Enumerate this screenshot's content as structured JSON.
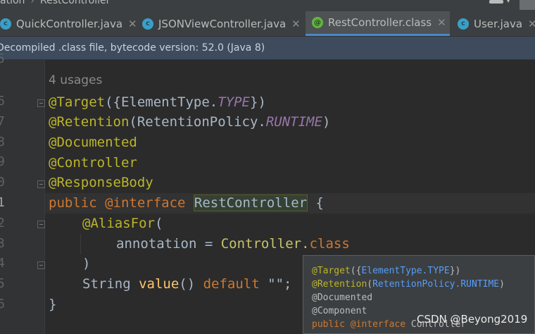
{
  "breadcrumb": {
    "left": "ation",
    "right": "RestController"
  },
  "tabs": [
    {
      "label": "QuickController.java",
      "icon": "class-icon",
      "active": false
    },
    {
      "label": "JSONViewController.java",
      "icon": "class-icon",
      "active": false
    },
    {
      "label": "RestController.class",
      "icon": "annotation-icon",
      "active": true
    },
    {
      "label": "User.java",
      "icon": "class-icon",
      "active": false
    }
  ],
  "banner": "Decompiled .class file, bytecode version: 52.0 (Java 8)",
  "gutter": {
    "line_numbers": [
      "5",
      "6",
      "7",
      "8",
      "9",
      "0",
      "1",
      "2",
      "3",
      "4",
      "5",
      "6"
    ]
  },
  "editor": {
    "usages": "4 usages",
    "l6": {
      "a": "@Target",
      "b": "({ElementType.",
      "c": "TYPE",
      "d": "})"
    },
    "l7": {
      "a": "@Retention",
      "b": "(RetentionPolicy.",
      "c": "RUNTIME",
      "d": ")"
    },
    "l8": "@Documented",
    "l9": "@Controller",
    "l10": "@ResponseBody",
    "l11": {
      "kw1": "public ",
      "kw2": "@interface",
      "name": "RestController",
      "brace": " {"
    },
    "l12": {
      "a": "@AliasFor",
      "b": "("
    },
    "l13": {
      "a": "annotation = ",
      "b": "Controller.",
      "c": "class"
    },
    "l14": ")",
    "l15": {
      "a": "String ",
      "b": "value",
      "c": "() ",
      "d": "default",
      "e": " \"\";"
    },
    "l16": "}"
  },
  "popup": {
    "l1": {
      "a": "@Target",
      "b": "({",
      "c": "ElementType.TYPE",
      "d": "})"
    },
    "l2": {
      "a": "@Retention",
      "b": "(",
      "c": "RetentionPolicy.RUNTIME",
      "d": ")"
    },
    "l3": "@Documented",
    "l4": "@Component",
    "l5": {
      "a": "public ",
      "b": "@interface",
      "c": " Controller"
    }
  },
  "watermark": "CSDN @Beyong2019"
}
